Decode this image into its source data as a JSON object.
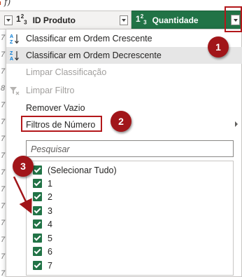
{
  "formula_bar": {
    "fx": "f)"
  },
  "columns": {
    "produto": {
      "type_icon": "1²3",
      "name": "ID Produto"
    },
    "quantidade": {
      "type_icon": "1²3",
      "name": "Quantidade"
    }
  },
  "row_strip": [
    "7",
    "7",
    "7",
    "8",
    "7",
    "7",
    "7",
    "7",
    "7",
    "7",
    "7",
    "7",
    "7",
    "7",
    "7"
  ],
  "menu": {
    "sort_asc": "Classificar em Ordem Crescente",
    "sort_desc": "Classificar em Ordem Decrescente",
    "clear_sort": "Limpar Classificação",
    "clear_filter": "Limpar Filtro",
    "remove_empty": "Remover Vazio",
    "number_filters": "Filtros de Número"
  },
  "search": {
    "placeholder": "Pesquisar"
  },
  "values": [
    {
      "label": "(Selecionar Tudo)",
      "checked": true
    },
    {
      "label": "1",
      "checked": true
    },
    {
      "label": "2",
      "checked": true
    },
    {
      "label": "3",
      "checked": true
    },
    {
      "label": "4",
      "checked": true
    },
    {
      "label": "5",
      "checked": true
    },
    {
      "label": "6",
      "checked": true
    },
    {
      "label": "7",
      "checked": true
    }
  ],
  "annotations": {
    "badge1": "1",
    "badge2": "2",
    "badge3": "3"
  },
  "colors": {
    "accent_green": "#217346",
    "annotation_red": "#a11519"
  }
}
